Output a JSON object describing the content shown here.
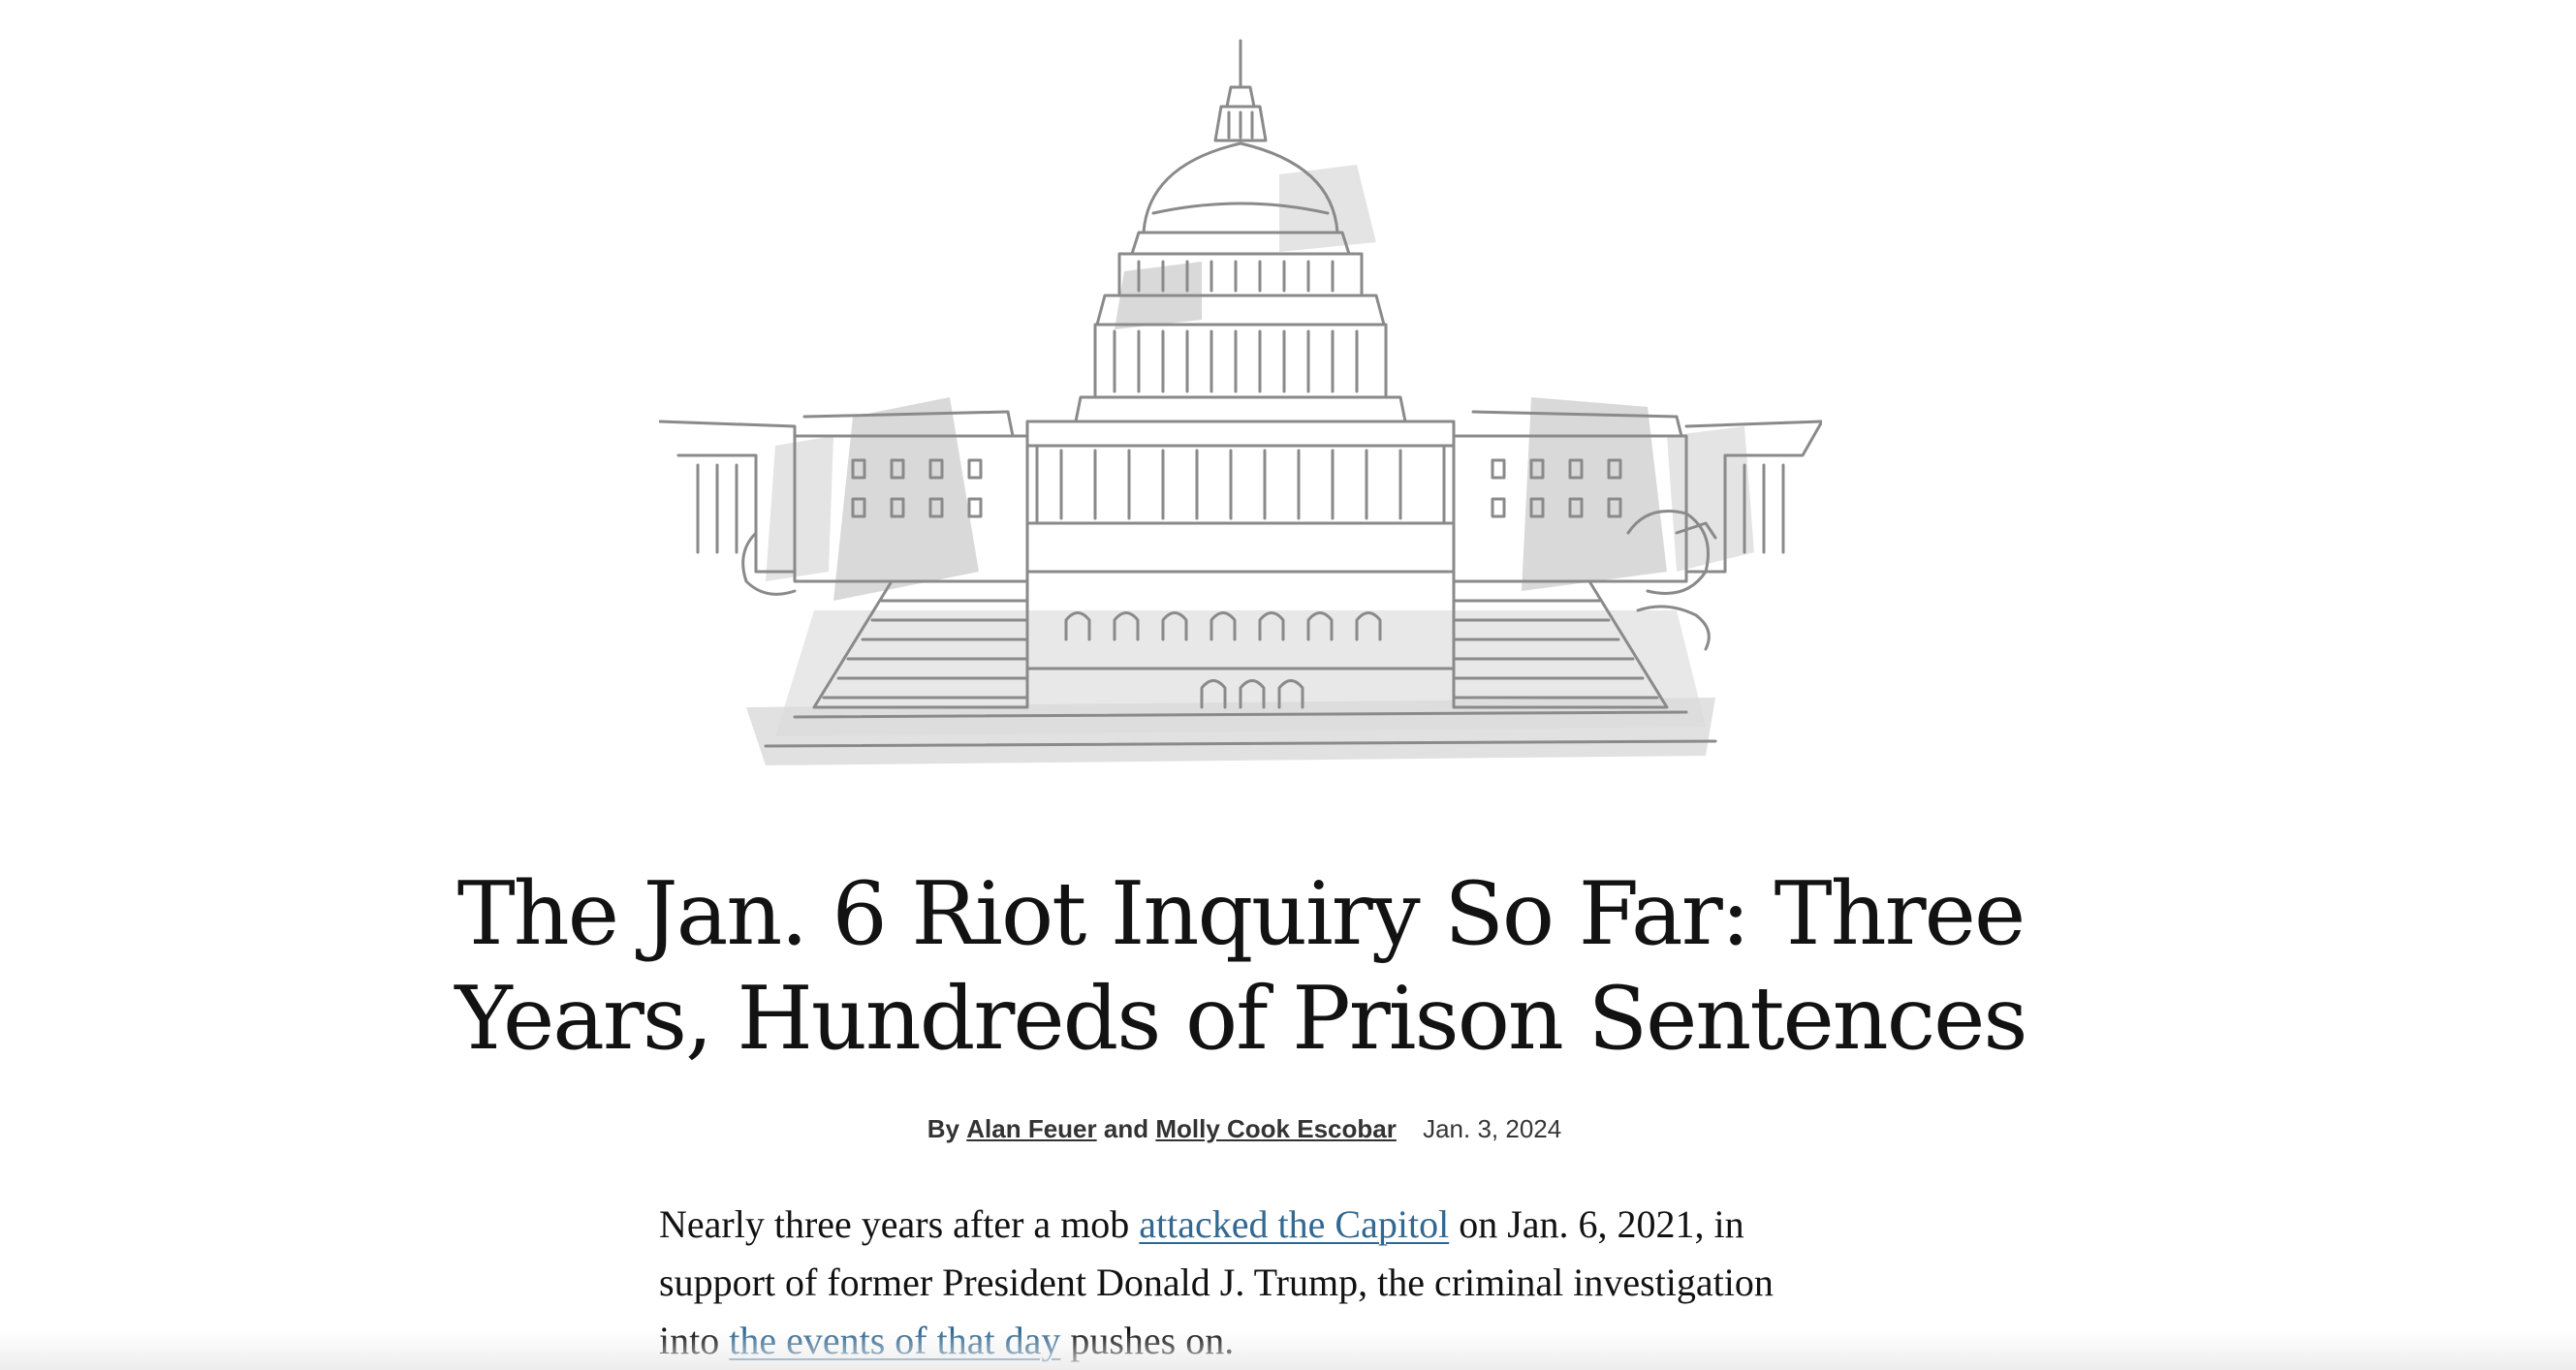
{
  "article": {
    "illustration_icon": "capitol-building-illustration",
    "headline_line1": "The Jan. 6 Riot Inquiry So Far: Three",
    "headline_line2": "Years, Hundreds of Prison Sentences",
    "byline": {
      "prefix": "By",
      "author1": "Alan Feuer",
      "conjunction": "and",
      "author2": "Molly Cook Escobar",
      "date": "Jan. 3, 2024"
    },
    "lede": {
      "part1": "Nearly three years after a mob ",
      "link1": "attacked the Capitol",
      "part2": " on Jan. 6, 2021, in support of former President Donald J. Trump, the criminal investigation into ",
      "link2": "the events of that day",
      "part3": " pushes on."
    }
  },
  "colors": {
    "link": "#326891",
    "text": "#121212",
    "sketch_line": "#8a8a8a",
    "sketch_shade": "#d6d6d6"
  }
}
